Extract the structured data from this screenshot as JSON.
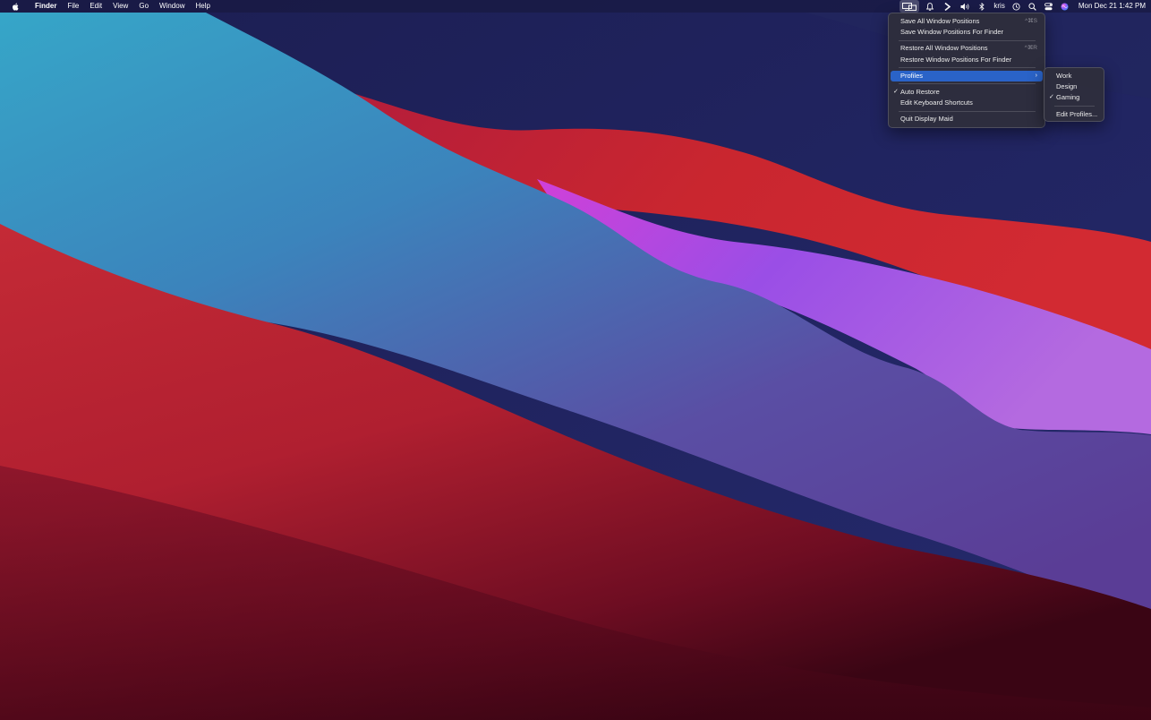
{
  "menubar": {
    "app_name": "Finder",
    "menus": [
      "File",
      "Edit",
      "View",
      "Go",
      "Window",
      "Help"
    ],
    "tray_icons": [
      "display-maid-icon",
      "notification-bell-icon",
      "chevron-right-icon",
      "volume-icon",
      "bluetooth-icon",
      "time-machine-icon",
      "spotlight-search-icon",
      "control-center-icon",
      "siri-icon"
    ],
    "user": "kris",
    "clock": "Mon Dec 21  1:42 PM"
  },
  "display_maid_menu": {
    "items": [
      {
        "label": "Save All Window Positions",
        "shortcut": "^⌘S"
      },
      {
        "label": "Save Window Positions For Finder",
        "shortcut": ""
      },
      {
        "label": "Restore All Window Positions",
        "shortcut": "^⌘R"
      },
      {
        "label": "Restore Window Positions For Finder",
        "shortcut": ""
      },
      {
        "label": "Profiles",
        "submenu": true,
        "highlighted": true
      },
      {
        "label": "Auto Restore",
        "checked": true
      },
      {
        "label": "Edit Keyboard Shortcuts"
      },
      {
        "label": "Quit Display Maid"
      }
    ]
  },
  "profiles_submenu": {
    "items": [
      {
        "label": "Work",
        "checked": false
      },
      {
        "label": "Design",
        "checked": false
      },
      {
        "label": "Gaming",
        "checked": true
      },
      {
        "label": "Edit Profiles...",
        "checked": false
      }
    ]
  },
  "glyphs": {
    "check": "✓",
    "submenu_arrow": "›"
  },
  "colors": {
    "menu_highlight": "#2a63c8",
    "wallpaper_navy": "#1b1d4f",
    "wallpaper_teal": "#2fa0c8",
    "wallpaper_red": "#c8243a",
    "wallpaper_violet": "#a84ee0",
    "wallpaper_maroon": "#4a0616"
  }
}
